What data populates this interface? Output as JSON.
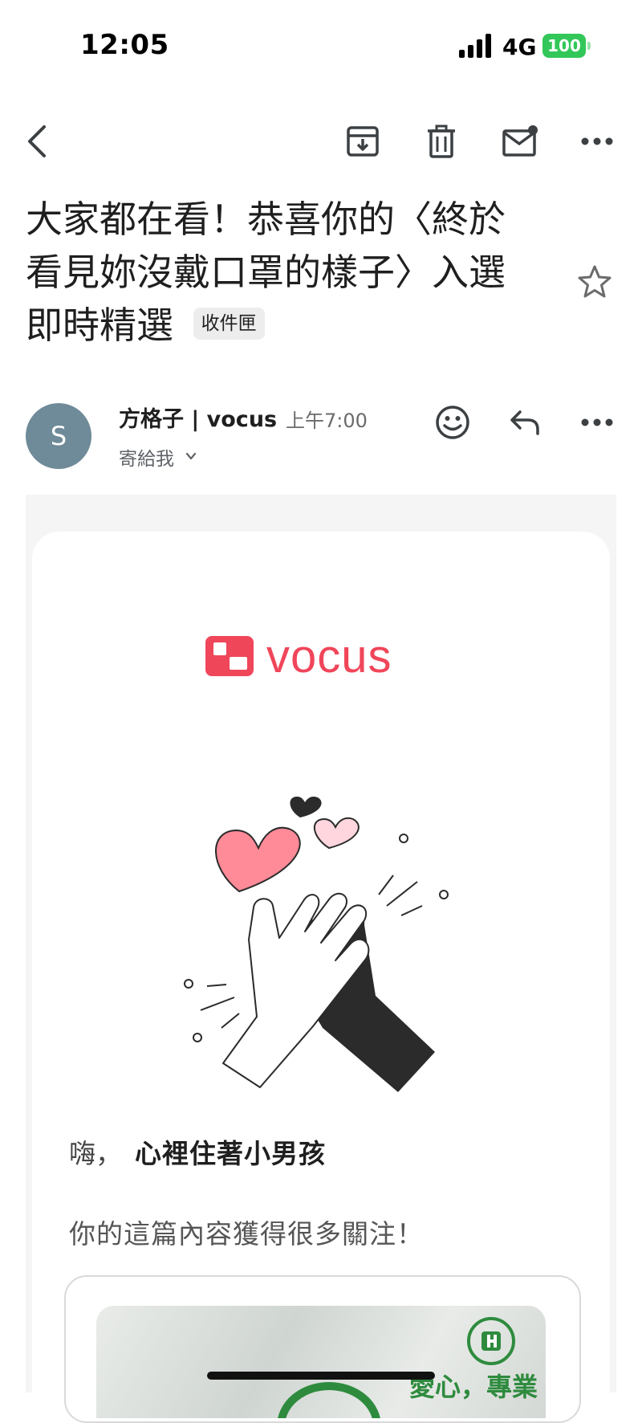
{
  "status_bar": {
    "time": "12:05",
    "network": "4G",
    "battery": "100"
  },
  "toolbar": {
    "back_icon": "back-arrow-icon",
    "archive_icon": "archive-icon",
    "delete_icon": "trash-icon",
    "mark_unread_icon": "mail-unread-icon",
    "more_icon": "more-horizontal-icon"
  },
  "email": {
    "subject": "大家都在看！恭喜你的〈終於看見妳沒戴口罩的樣子〉入選即時精選",
    "label_chip": "收件匣",
    "sender_initial": "S",
    "sender_name": "方格子 | vocus",
    "sent_time": "上午7:00",
    "recipient": "寄給我"
  },
  "body": {
    "brand": "vocus",
    "greeting": "嗨，",
    "greeting_name": "心裡住著小男孩",
    "lead": "你的這篇內容獲得很多關注！",
    "thumb_text": "愛心，專業"
  },
  "colors": {
    "brand_red": "#f0465a",
    "heart_pink": "#ff8a98",
    "heart_light": "#ffd6dd",
    "battery_green": "#33c759"
  }
}
